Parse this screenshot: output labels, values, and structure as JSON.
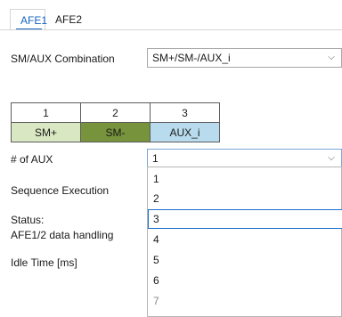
{
  "tabs": [
    {
      "label": "AFE1",
      "active": true
    },
    {
      "label": "AFE2",
      "active": false
    }
  ],
  "combination": {
    "label": "SM/AUX Combination",
    "value": "SM+/SM-/AUX_i"
  },
  "channel_grid": {
    "headers": [
      "1",
      "2",
      "3"
    ],
    "cells": [
      {
        "label": "SM+",
        "color": "#d9e8c2"
      },
      {
        "label": "SM-",
        "color": "#77933c"
      },
      {
        "label": "AUX_i",
        "color": "#b8dced"
      }
    ]
  },
  "aux_count": {
    "label": "# of AUX",
    "value": "1",
    "options": [
      "1",
      "2",
      "3",
      "4",
      "5",
      "6",
      "7"
    ],
    "highlighted": "3"
  },
  "sequence": {
    "label": "Sequence Execution"
  },
  "status": {
    "label": "Status:",
    "value": "AFE1/2 data handling"
  },
  "idle": {
    "label": "Idle Time [ms]"
  },
  "colors": {
    "accent": "#1565c0",
    "border": "#a8a8a8",
    "focus": "#1a6fd1"
  }
}
